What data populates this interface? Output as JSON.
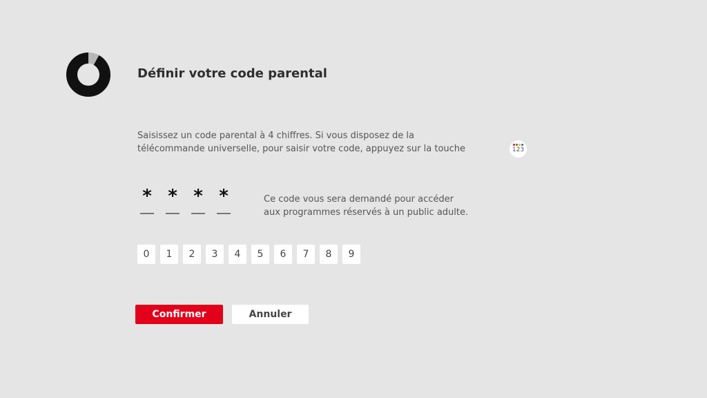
{
  "header": {
    "title": "Définir votre code parental",
    "progress": 0.92
  },
  "instructions": {
    "line1": "Saisissez un code parental à 4 chiffres. Si vous disposez de la",
    "line2": "télécommande universelle, pour saisir votre code, appuyez sur la touche",
    "remote_key": {
      "icon": "remote-123-key-icon",
      "label": "123",
      "dot_colors": [
        "#e2001a",
        "#2e7d32",
        "#f2b705",
        "#1e63b5"
      ]
    }
  },
  "code": {
    "slots": [
      {
        "mask": "*"
      },
      {
        "mask": "*"
      },
      {
        "mask": "*"
      },
      {
        "mask": "*"
      }
    ],
    "hint_line1": "Ce code vous sera demandé pour accéder",
    "hint_line2": "aux programmes réservés à un public adulte."
  },
  "keypad": {
    "keys": [
      "0",
      "1",
      "2",
      "3",
      "4",
      "5",
      "6",
      "7",
      "8",
      "9"
    ]
  },
  "actions": {
    "confirm_label": "Confirmer",
    "cancel_label": "Annuler"
  },
  "colors": {
    "background": "#e5e5e5",
    "accent": "#e2001a",
    "ring": "#111111",
    "ring_track": "#b8b8b8"
  }
}
